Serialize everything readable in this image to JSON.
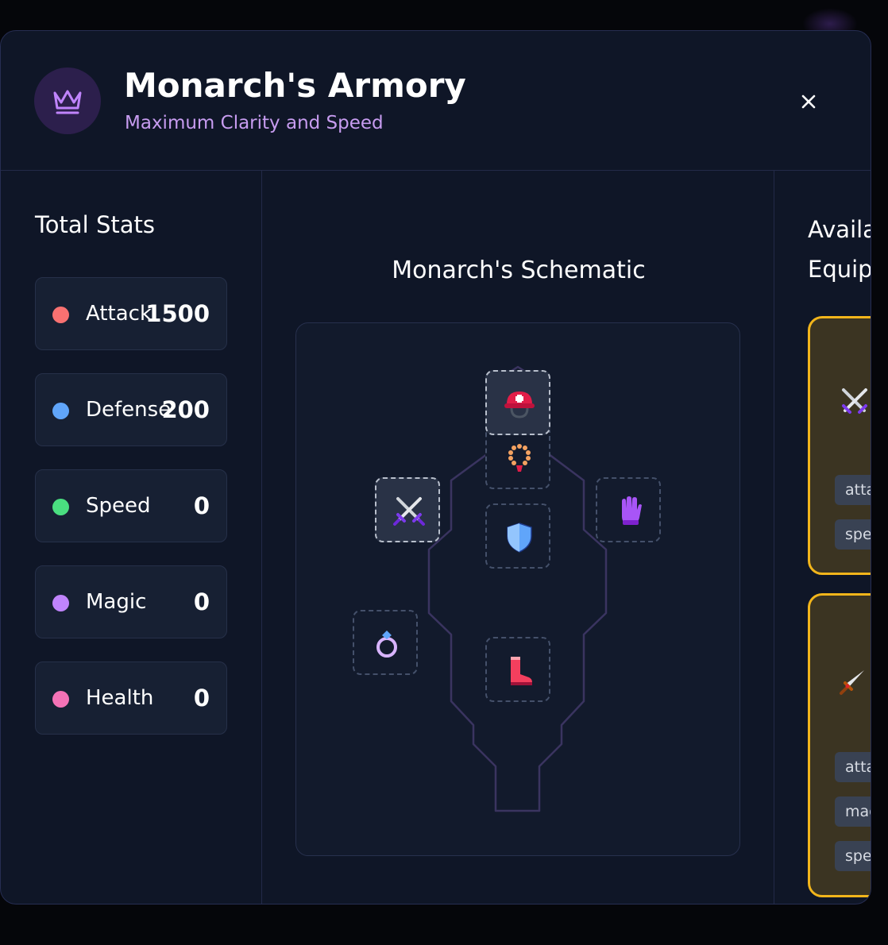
{
  "header": {
    "title": "Monarch's Armory",
    "subtitle": "Maximum Clarity and Speed",
    "close_label": "×"
  },
  "stats": {
    "heading": "Total Stats",
    "items": [
      {
        "label": "Attack",
        "value": "1500",
        "color": "#f87171"
      },
      {
        "label": "Defense",
        "value": "200",
        "color": "#60a5fa"
      },
      {
        "label": "Speed",
        "value": "0",
        "color": "#4ade80"
      },
      {
        "label": "Magic",
        "value": "0",
        "color": "#c084fc"
      },
      {
        "label": "Health",
        "value": "0",
        "color": "#f472b6"
      }
    ]
  },
  "schematic": {
    "heading": "Monarch's Schematic",
    "slots": [
      {
        "name": "helmet-slot",
        "icon": "helmet-icon",
        "filled": true
      },
      {
        "name": "amulet-slot",
        "icon": "beads-icon",
        "filled": false
      },
      {
        "name": "weapon-slot",
        "icon": "crossed-swords-icon",
        "filled": true
      },
      {
        "name": "gloves-slot",
        "icon": "gloves-icon",
        "filled": false
      },
      {
        "name": "armor-slot",
        "icon": "shield-icon",
        "filled": false
      },
      {
        "name": "ring-slot",
        "icon": "ring-icon",
        "filled": false
      },
      {
        "name": "boots-slot",
        "icon": "boot-icon",
        "filled": false
      }
    ]
  },
  "equipment": {
    "heading_line1": "Availa",
    "heading_line2": "Equip",
    "items": [
      {
        "icon": "crossed-swords-icon",
        "stats": [
          "atta",
          "spee"
        ]
      },
      {
        "icon": "dagger-icon",
        "stats": [
          "atta",
          "mag",
          "spee"
        ]
      }
    ]
  },
  "colors": {
    "accent": "#c084fc",
    "card_border": "#f2b51b"
  }
}
